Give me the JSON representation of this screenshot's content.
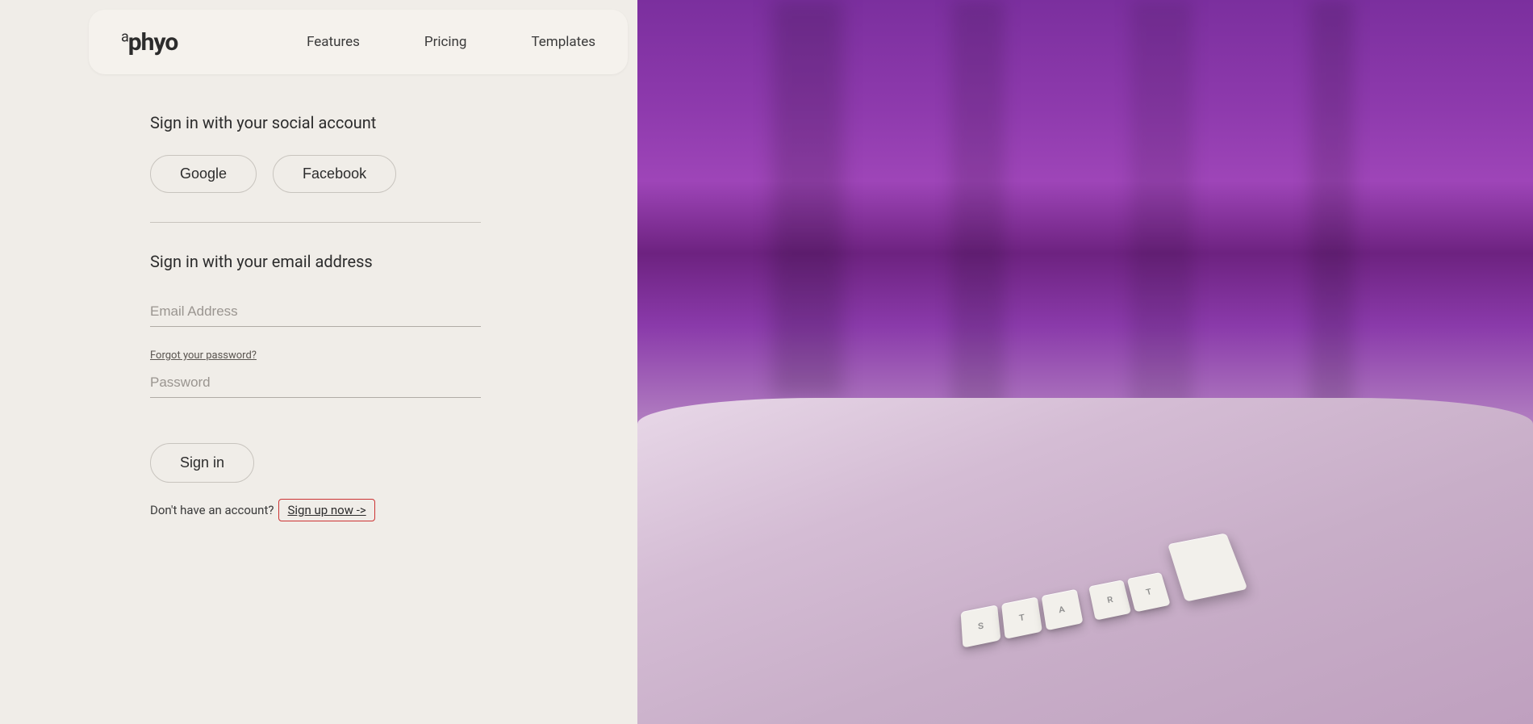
{
  "nav": {
    "logo": "aphyo",
    "logo_prefix": "a",
    "links": [
      {
        "label": "Features",
        "id": "features"
      },
      {
        "label": "Pricing",
        "id": "pricing"
      },
      {
        "label": "Templates",
        "id": "templates"
      }
    ]
  },
  "signin": {
    "social_title": "Sign in with your social account",
    "google_label": "Google",
    "facebook_label": "Facebook",
    "email_title": "Sign in with your email address",
    "email_placeholder": "Email Address",
    "password_placeholder": "Password",
    "forgot_password_label": "Forgot your password?",
    "sign_in_button": "Sign in",
    "no_account_text": "Don't have an account?",
    "sign_up_link": "Sign up now ->"
  },
  "keyboard_keys": [
    "S",
    "T",
    "A",
    "R",
    "T"
  ]
}
